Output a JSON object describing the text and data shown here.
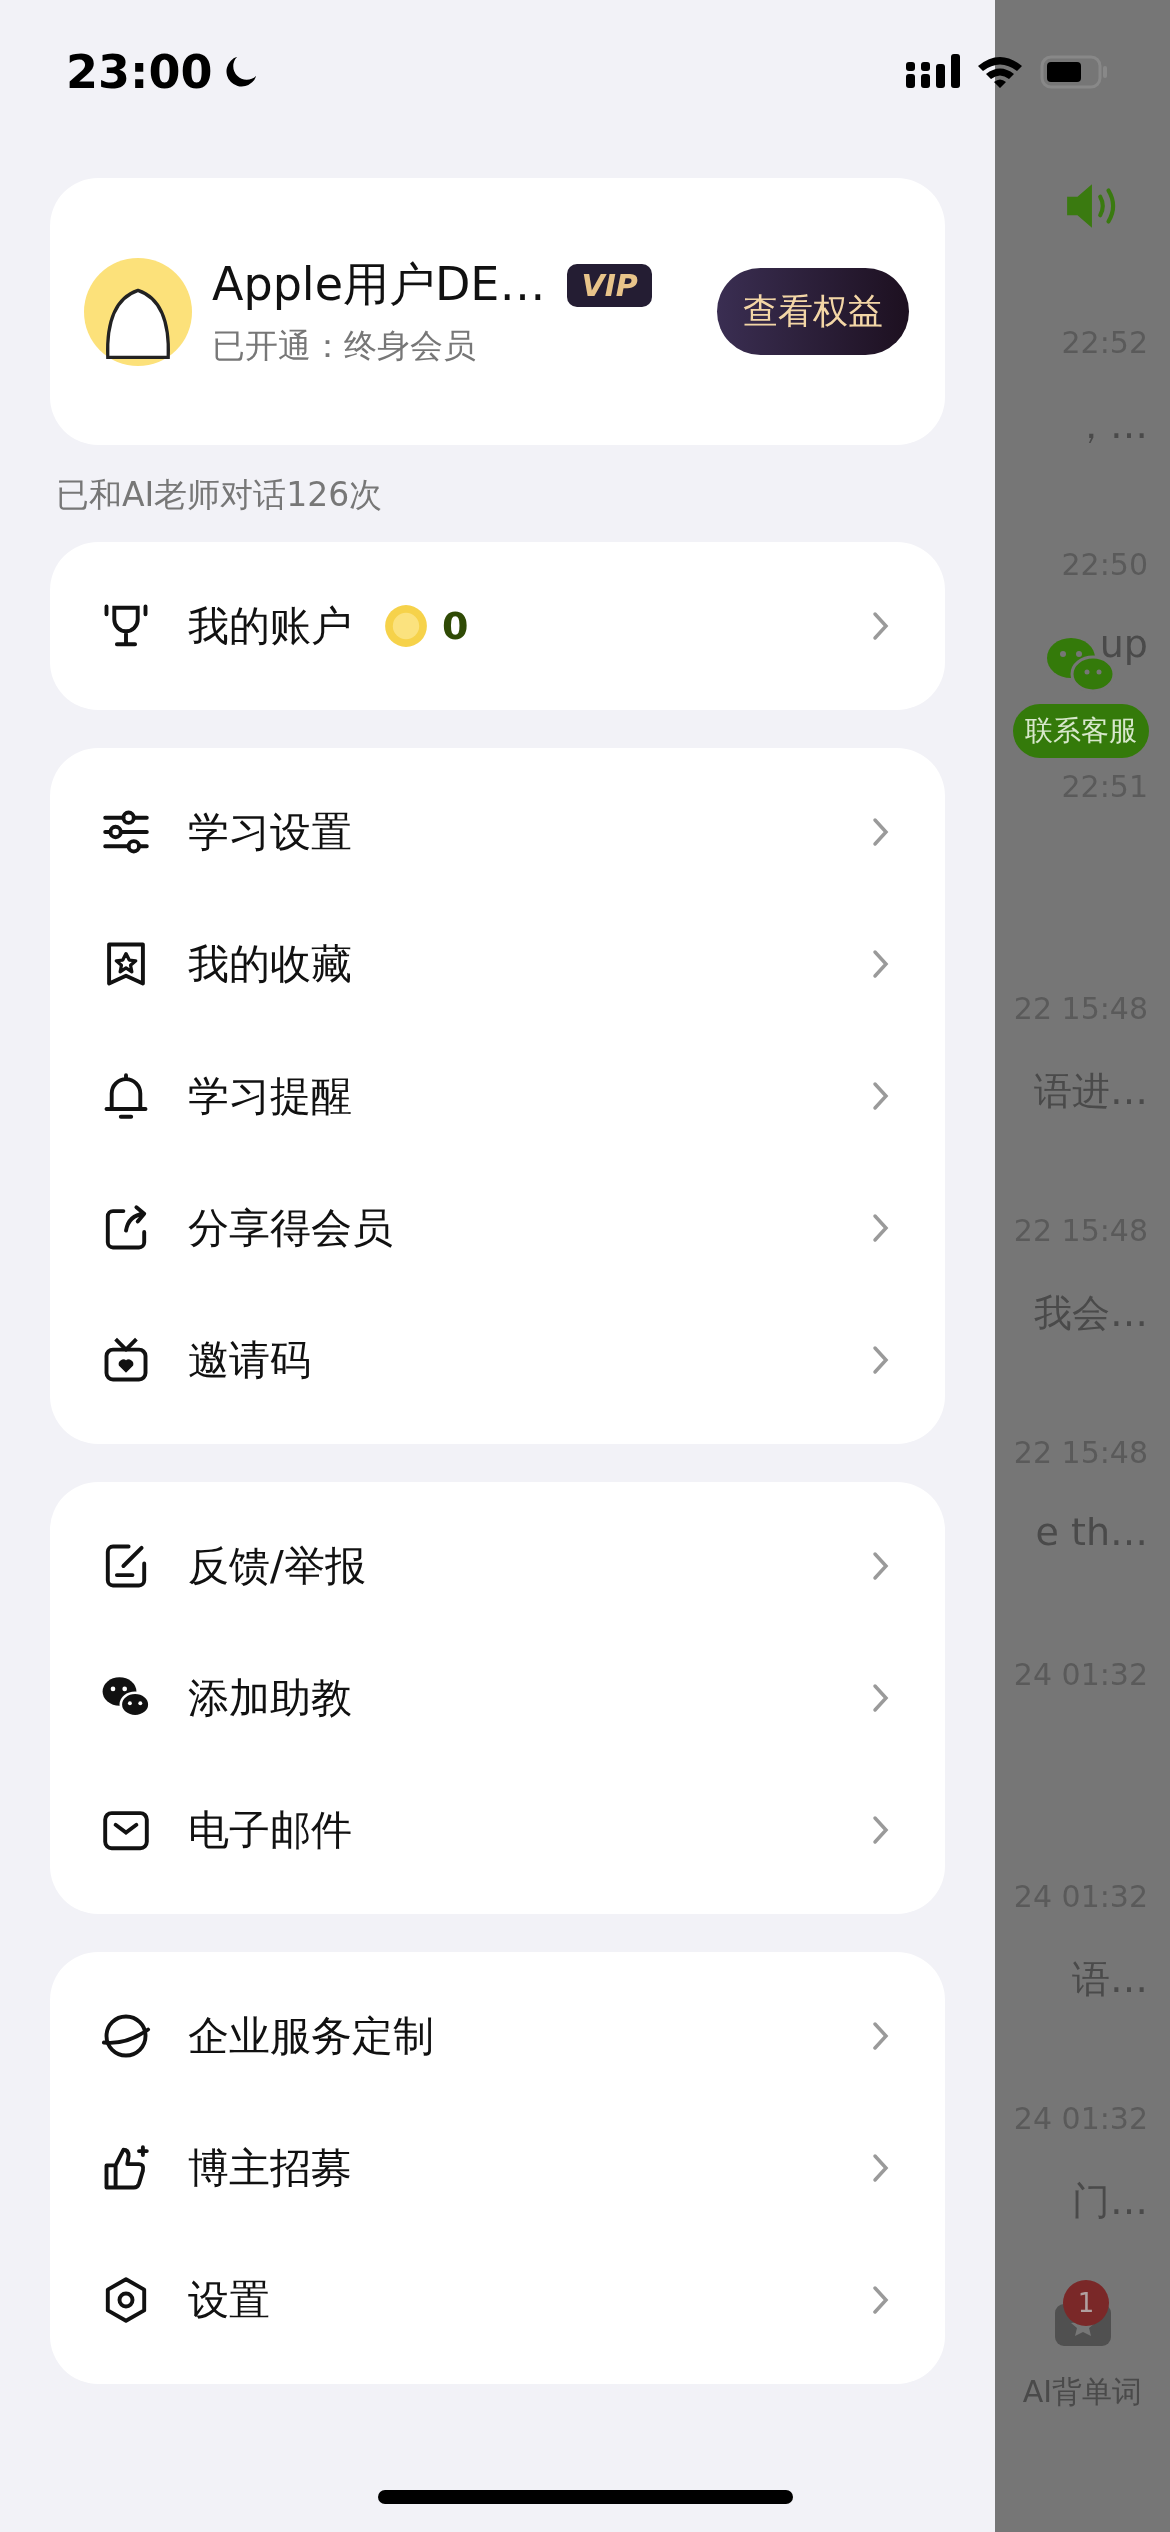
{
  "status_bar": {
    "time": "23:00"
  },
  "profile": {
    "name": "Apple用户DE…",
    "vip_badge": "VIP",
    "membership": "已开通：终身会员",
    "benefits_button": "查看权益"
  },
  "chat_count": "已和AI老师对话126次",
  "account": {
    "label": "我的账户",
    "coins": "0"
  },
  "menu_groups": [
    [
      {
        "label": "学习设置"
      },
      {
        "label": "我的收藏"
      },
      {
        "label": "学习提醒"
      },
      {
        "label": "分享得会员"
      },
      {
        "label": "邀请码"
      }
    ],
    [
      {
        "label": "反馈/举报"
      },
      {
        "label": "添加助教"
      },
      {
        "label": "电子邮件"
      }
    ],
    [
      {
        "label": "企业服务定制"
      },
      {
        "label": "博主招募"
      },
      {
        "label": "设置"
      }
    ]
  ],
  "background": {
    "sessions": [
      {
        "time": "22:52",
        "preview": "，…"
      },
      {
        "time": "22:50",
        "preview": "up"
      },
      {
        "time": "22:51"
      },
      {
        "time": "22 15:48",
        "preview": "语进…"
      },
      {
        "time": "22 15:48",
        "preview": "我会…"
      },
      {
        "time": "22 15:48",
        "preview": "e th…"
      },
      {
        "time": "24 01:32"
      },
      {
        "time": "24 01:32",
        "preview": "语…"
      },
      {
        "time": "24 01:32",
        "preview": "门…"
      }
    ],
    "support_button": "联系客服",
    "tab": {
      "label": "AI背单词",
      "badge": "1"
    }
  }
}
